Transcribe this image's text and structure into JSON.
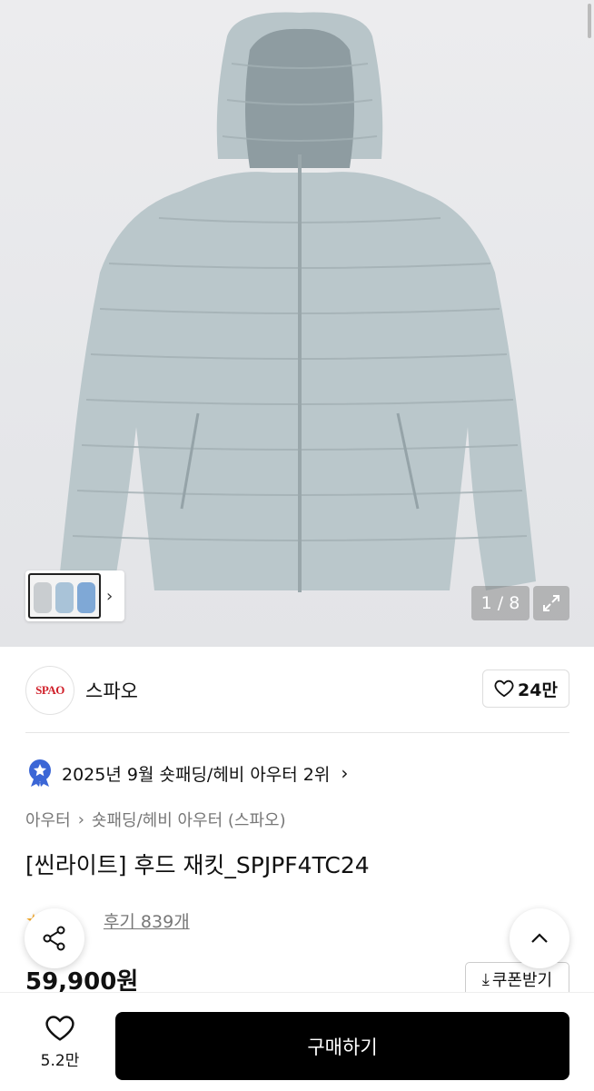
{
  "gallery": {
    "counter": "1 / 8",
    "colors": {
      "jacket": "#b9c6ca",
      "jacket_dark": "#9fadb2",
      "background": "#e8e9ec"
    },
    "icons": {
      "next": "chevron-right-icon",
      "expand": "expand-icon"
    }
  },
  "brand": {
    "logo_text": "SPAO",
    "name": "스파오",
    "likes": "24만"
  },
  "ranking": {
    "text": "2025년 9월 숏패딩/헤비 아우터 2위"
  },
  "breadcrumb": {
    "category": "아우터",
    "subcategory": "숏패딩/헤비 아우터 (스파오)"
  },
  "product": {
    "title": "[씬라이트] 후드 재킷_SPJPF4TC24",
    "review_link": "후기 839개",
    "price": "59,900원",
    "coupon_label": "쿠폰받기"
  },
  "bottom_bar": {
    "wish_count": "5.2만",
    "buy_label": "구매하기"
  },
  "accent": {
    "rank_badge": "#3b66d6",
    "brand_red": "#d0202a",
    "star": "#f5a623"
  }
}
